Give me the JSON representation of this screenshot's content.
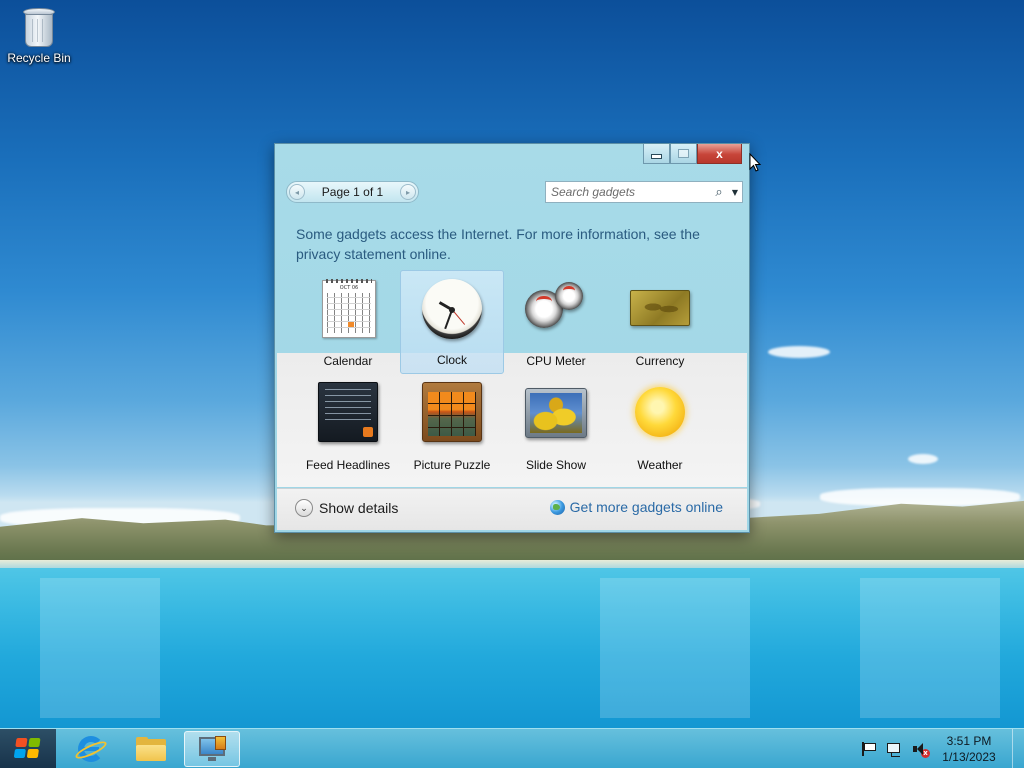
{
  "desktop": {
    "icons": [
      {
        "label": "Recycle Bin",
        "icon": "recycle-bin-icon"
      }
    ]
  },
  "gadget_window": {
    "controls": {
      "minimize": "minimize-icon",
      "maximize": "maximize-icon",
      "close_label": "x"
    },
    "pager": {
      "label": "Page 1 of 1",
      "prev": "◂",
      "next": "▸"
    },
    "search": {
      "placeholder": "Search gadgets",
      "icon": "search-icon",
      "dropdown": "▼"
    },
    "notice": "Some gadgets access the Internet.  For more information, see the privacy statement online.",
    "gadgets": [
      {
        "name": "Calendar",
        "icon": "calendar-icon",
        "selected": false,
        "calendar_month": "OCT 06"
      },
      {
        "name": "Clock",
        "icon": "clock-icon",
        "selected": true
      },
      {
        "name": "CPU Meter",
        "icon": "cpu-meter-icon",
        "selected": false
      },
      {
        "name": "Currency",
        "icon": "currency-icon",
        "selected": false
      },
      {
        "name": "Feed Headlines",
        "icon": "feed-headlines-icon",
        "selected": false
      },
      {
        "name": "Picture Puzzle",
        "icon": "picture-puzzle-icon",
        "selected": false
      },
      {
        "name": "Slide Show",
        "icon": "slide-show-icon",
        "selected": false
      },
      {
        "name": "Weather",
        "icon": "weather-icon",
        "selected": false
      }
    ],
    "footer": {
      "show_details": "Show details",
      "show_details_chevron": "⌄",
      "more_gadgets": "Get more gadgets online"
    }
  },
  "taskbar": {
    "start": "windows-start-icon",
    "pinned": [
      {
        "name": "Internet Explorer",
        "icon": "internet-explorer-icon",
        "active": false
      },
      {
        "name": "File Explorer",
        "icon": "folder-icon",
        "active": false
      },
      {
        "name": "Desktop Gadget Gallery",
        "icon": "gadget-gallery-icon",
        "active": true
      }
    ],
    "tray": [
      "action-center-flag-icon",
      "network-icon",
      "volume-muted-icon"
    ],
    "volume_badge": "x",
    "time": "3:51 PM",
    "date": "1/13/2023"
  },
  "colors": {
    "window_bg": "#a8dbe8",
    "link": "#2a6aa6",
    "notice_text": "#2a5b80",
    "close_button": "#c7453a",
    "taskbar": "#3caad2"
  }
}
